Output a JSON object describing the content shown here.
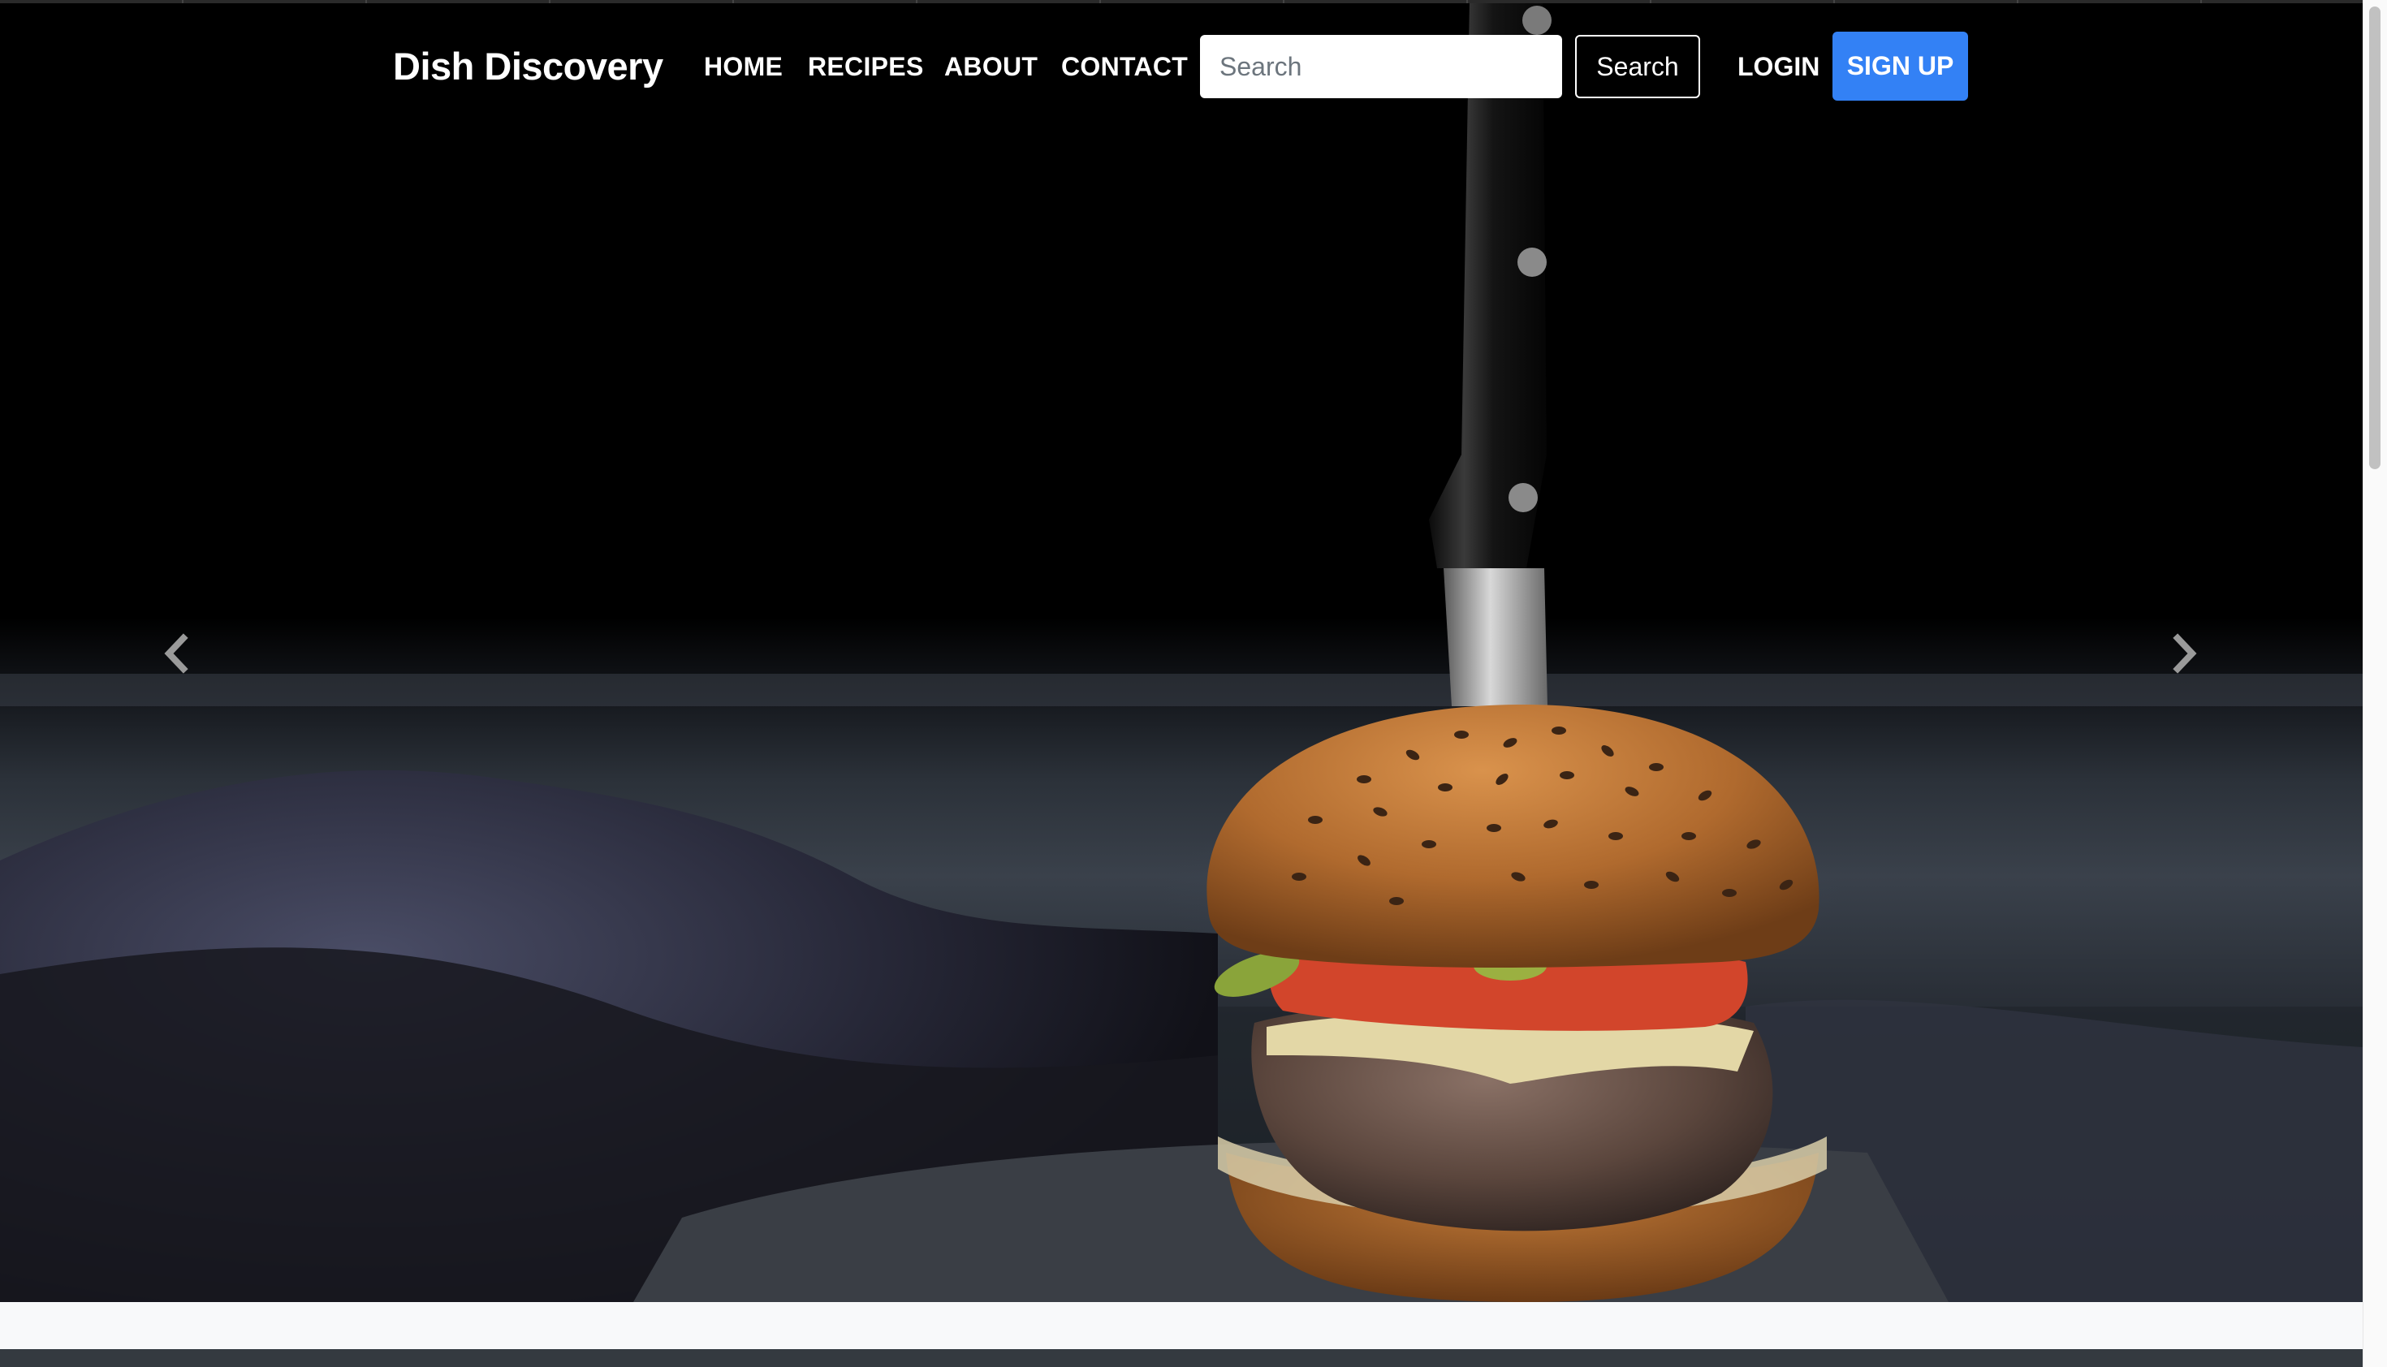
{
  "navbar": {
    "brand": "Dish Discovery",
    "links": [
      {
        "label": "HOME"
      },
      {
        "label": "RECIPES"
      },
      {
        "label": "ABOUT"
      },
      {
        "label": "CONTACT"
      }
    ],
    "search": {
      "placeholder": "Search",
      "value": "",
      "button_label": "Search"
    },
    "login_label": "LOGIN",
    "signup_label": "SIGN UP"
  },
  "hero": {
    "image_subject": "burger with knife on dark table",
    "prev_icon": "chevron-left-icon",
    "next_icon": "chevron-right-icon"
  },
  "colors": {
    "accent": "#3381f5",
    "navbar_text": "#ffffff",
    "content_band": "#f8f9fa",
    "footer_band": "#343a40"
  }
}
